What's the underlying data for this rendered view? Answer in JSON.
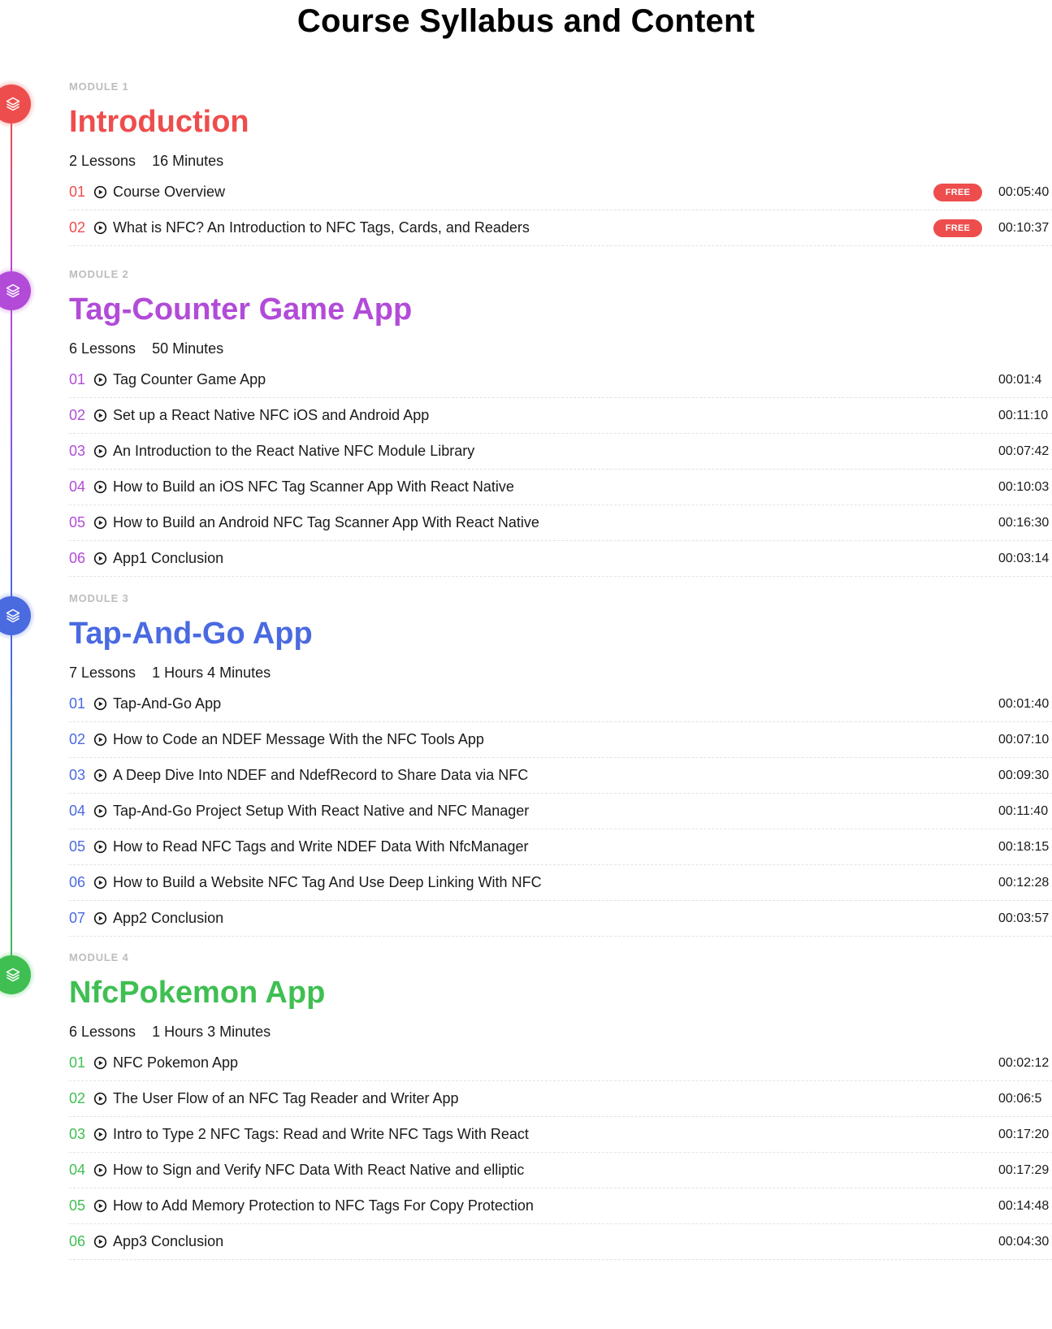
{
  "page": {
    "title": "Course Syllabus and Content"
  },
  "colors": {
    "module1": "#ee4d4d",
    "module2": "#b24bd8",
    "module3": "#4a6ae0",
    "module4": "#3fbf52",
    "badge": "#ee4d4d"
  },
  "modules": [
    {
      "label": "MODULE 1",
      "title": "Introduction",
      "lessons_count": "2 Lessons",
      "duration": "16 Minutes",
      "icon": "layers-icon",
      "lessons": [
        {
          "num": "01",
          "title": "Course Overview",
          "badge": "FREE",
          "duration": "00:05:40"
        },
        {
          "num": "02",
          "title": "What is NFC? An Introduction to NFC Tags, Cards, and Readers",
          "badge": "FREE",
          "duration": "00:10:37"
        }
      ]
    },
    {
      "label": "MODULE 2",
      "title": "Tag-Counter Game App",
      "lessons_count": "6 Lessons",
      "duration": "50 Minutes",
      "icon": "layers-icon",
      "lessons": [
        {
          "num": "01",
          "title": "Tag Counter Game App",
          "duration": "00:01:4"
        },
        {
          "num": "02",
          "title": "Set up a React Native NFC iOS and Android App",
          "duration": "00:11:10"
        },
        {
          "num": "03",
          "title": "An Introduction to the React Native NFC Module Library",
          "duration": "00:07:42"
        },
        {
          "num": "04",
          "title": "How to Build an iOS NFC Tag Scanner App With React Native",
          "duration": "00:10:03"
        },
        {
          "num": "05",
          "title": "How to Build an Android NFC Tag Scanner App With React Native",
          "duration": "00:16:30"
        },
        {
          "num": "06",
          "title": "App1 Conclusion",
          "duration": "00:03:14"
        }
      ]
    },
    {
      "label": "MODULE 3",
      "title": "Tap-And-Go App",
      "lessons_count": "7 Lessons",
      "duration": "1 Hours 4 Minutes",
      "icon": "layers-icon",
      "lessons": [
        {
          "num": "01",
          "title": "Tap-And-Go App",
          "duration": "00:01:40"
        },
        {
          "num": "02",
          "title": "How to Code an NDEF Message With the NFC Tools App",
          "duration": "00:07:10"
        },
        {
          "num": "03",
          "title": "A Deep Dive Into NDEF and NdefRecord to Share Data via NFC",
          "duration": "00:09:30"
        },
        {
          "num": "04",
          "title": "Tap-And-Go Project Setup With React Native and NFC Manager",
          "duration": "00:11:40"
        },
        {
          "num": "05",
          "title": "How to Read NFC Tags and Write NDEF Data With NfcManager",
          "duration": "00:18:15"
        },
        {
          "num": "06",
          "title": "How to Build a Website NFC Tag And Use Deep Linking With NFC",
          "duration": "00:12:28"
        },
        {
          "num": "07",
          "title": "App2 Conclusion",
          "duration": "00:03:57"
        }
      ]
    },
    {
      "label": "MODULE 4",
      "title": "NfcPokemon App",
      "lessons_count": "6 Lessons",
      "duration": "1 Hours 3 Minutes",
      "icon": "layers-icon",
      "lessons": [
        {
          "num": "01",
          "title": "NFC Pokemon App",
          "duration": "00:02:12"
        },
        {
          "num": "02",
          "title": "The User Flow of an NFC Tag Reader and Writer App",
          "duration": "00:06:5"
        },
        {
          "num": "03",
          "title": "Intro to Type 2 NFC Tags: Read and Write NFC Tags With React",
          "duration": "00:17:20"
        },
        {
          "num": "04",
          "title": "How to Sign and Verify NFC Data With React Native and elliptic",
          "duration": "00:17:29"
        },
        {
          "num": "05",
          "title": "How to Add Memory Protection to NFC Tags For Copy Protection",
          "duration": "00:14:48"
        },
        {
          "num": "06",
          "title": "App3 Conclusion",
          "duration": "00:04:30"
        }
      ]
    }
  ]
}
